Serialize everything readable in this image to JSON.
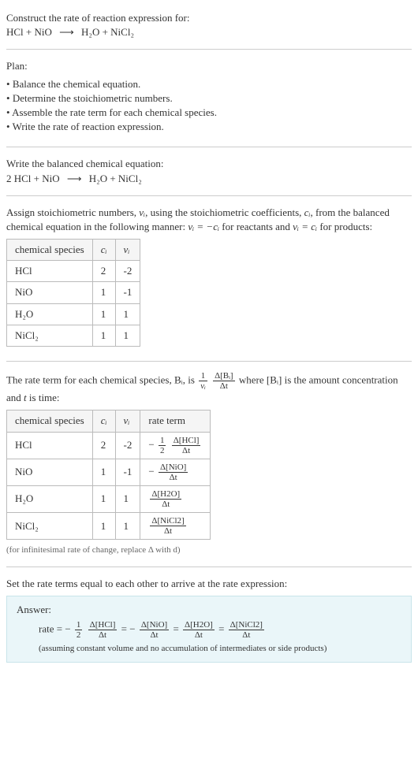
{
  "header": {
    "title": "Construct the rate of reaction expression for:",
    "equation_lhs": "HCl + NiO",
    "equation_rhs": "H₂O + NiCl₂"
  },
  "plan": {
    "label": "Plan:",
    "items": [
      "Balance the chemical equation.",
      "Determine the stoichiometric numbers.",
      "Assemble the rate term for each chemical species.",
      "Write the rate of reaction expression."
    ]
  },
  "balanced": {
    "label": "Write the balanced chemical equation:",
    "equation_lhs": "2 HCl + NiO",
    "equation_rhs": "H₂O + NiCl₂"
  },
  "stoich": {
    "intro_a": "Assign stoichiometric numbers, ",
    "intro_b": ", using the stoichiometric coefficients, ",
    "intro_c": ", from the balanced chemical equation in the following manner: ",
    "intro_d": " for reactants and ",
    "intro_e": " for products:",
    "headers": {
      "species": "chemical species",
      "ci": "cᵢ",
      "nui": "νᵢ"
    },
    "rows": [
      {
        "species": "HCl",
        "ci": "2",
        "nui": "-2"
      },
      {
        "species": "NiO",
        "ci": "1",
        "nui": "-1"
      },
      {
        "species": "H₂O",
        "ci": "1",
        "nui": "1"
      },
      {
        "species": "NiCl₂",
        "ci": "1",
        "nui": "1"
      }
    ]
  },
  "rateterm": {
    "intro_a": "The rate term for each chemical species, ",
    "intro_b": ", is ",
    "intro_c": " where ",
    "intro_d": " is the amount concentration and ",
    "intro_e": " is time:",
    "headers": {
      "species": "chemical species",
      "ci": "cᵢ",
      "nui": "νᵢ",
      "rate": "rate term"
    },
    "rows": [
      {
        "species": "HCl",
        "ci": "2",
        "nui": "-2",
        "prefix": "−",
        "frac_num": "1",
        "frac_den": "2",
        "delta": "Δ[HCl]",
        "dt": "Δt"
      },
      {
        "species": "NiO",
        "ci": "1",
        "nui": "-1",
        "prefix": "−",
        "frac_num": "",
        "frac_den": "",
        "delta": "Δ[NiO]",
        "dt": "Δt"
      },
      {
        "species": "H₂O",
        "ci": "1",
        "nui": "1",
        "prefix": "",
        "frac_num": "",
        "frac_den": "",
        "delta": "Δ[H2O]",
        "dt": "Δt"
      },
      {
        "species": "NiCl₂",
        "ci": "1",
        "nui": "1",
        "prefix": "",
        "frac_num": "",
        "frac_den": "",
        "delta": "Δ[NiCl2]",
        "dt": "Δt"
      }
    ],
    "note": "(for infinitesimal rate of change, replace Δ with d)"
  },
  "final": {
    "label": "Set the rate terms equal to each other to arrive at the rate expression:"
  },
  "answer": {
    "label": "Answer:",
    "rate_eq_prefix": "rate = −",
    "half_num": "1",
    "half_den": "2",
    "t1_num": "Δ[HCl]",
    "t1_den": "Δt",
    "eq": " = ",
    "neg": "−",
    "t2_num": "Δ[NiO]",
    "t2_den": "Δt",
    "t3_num": "Δ[H2O]",
    "t3_den": "Δt",
    "t4_num": "Δ[NiCl2]",
    "t4_den": "Δt",
    "assume": "(assuming constant volume and no accumulation of intermediates or side products)"
  },
  "sym": {
    "nu_i": "νᵢ",
    "c_i": "cᵢ",
    "Bi": "Bᵢ",
    "Bi_br": "[Bᵢ]",
    "t": "t",
    "arrow": "⟶",
    "nu_eq_neg_c": "νᵢ = −cᵢ",
    "nu_eq_c": "νᵢ = cᵢ",
    "one": "1",
    "delta_Bi": "Δ[Bᵢ]",
    "delta_t": "Δt"
  }
}
